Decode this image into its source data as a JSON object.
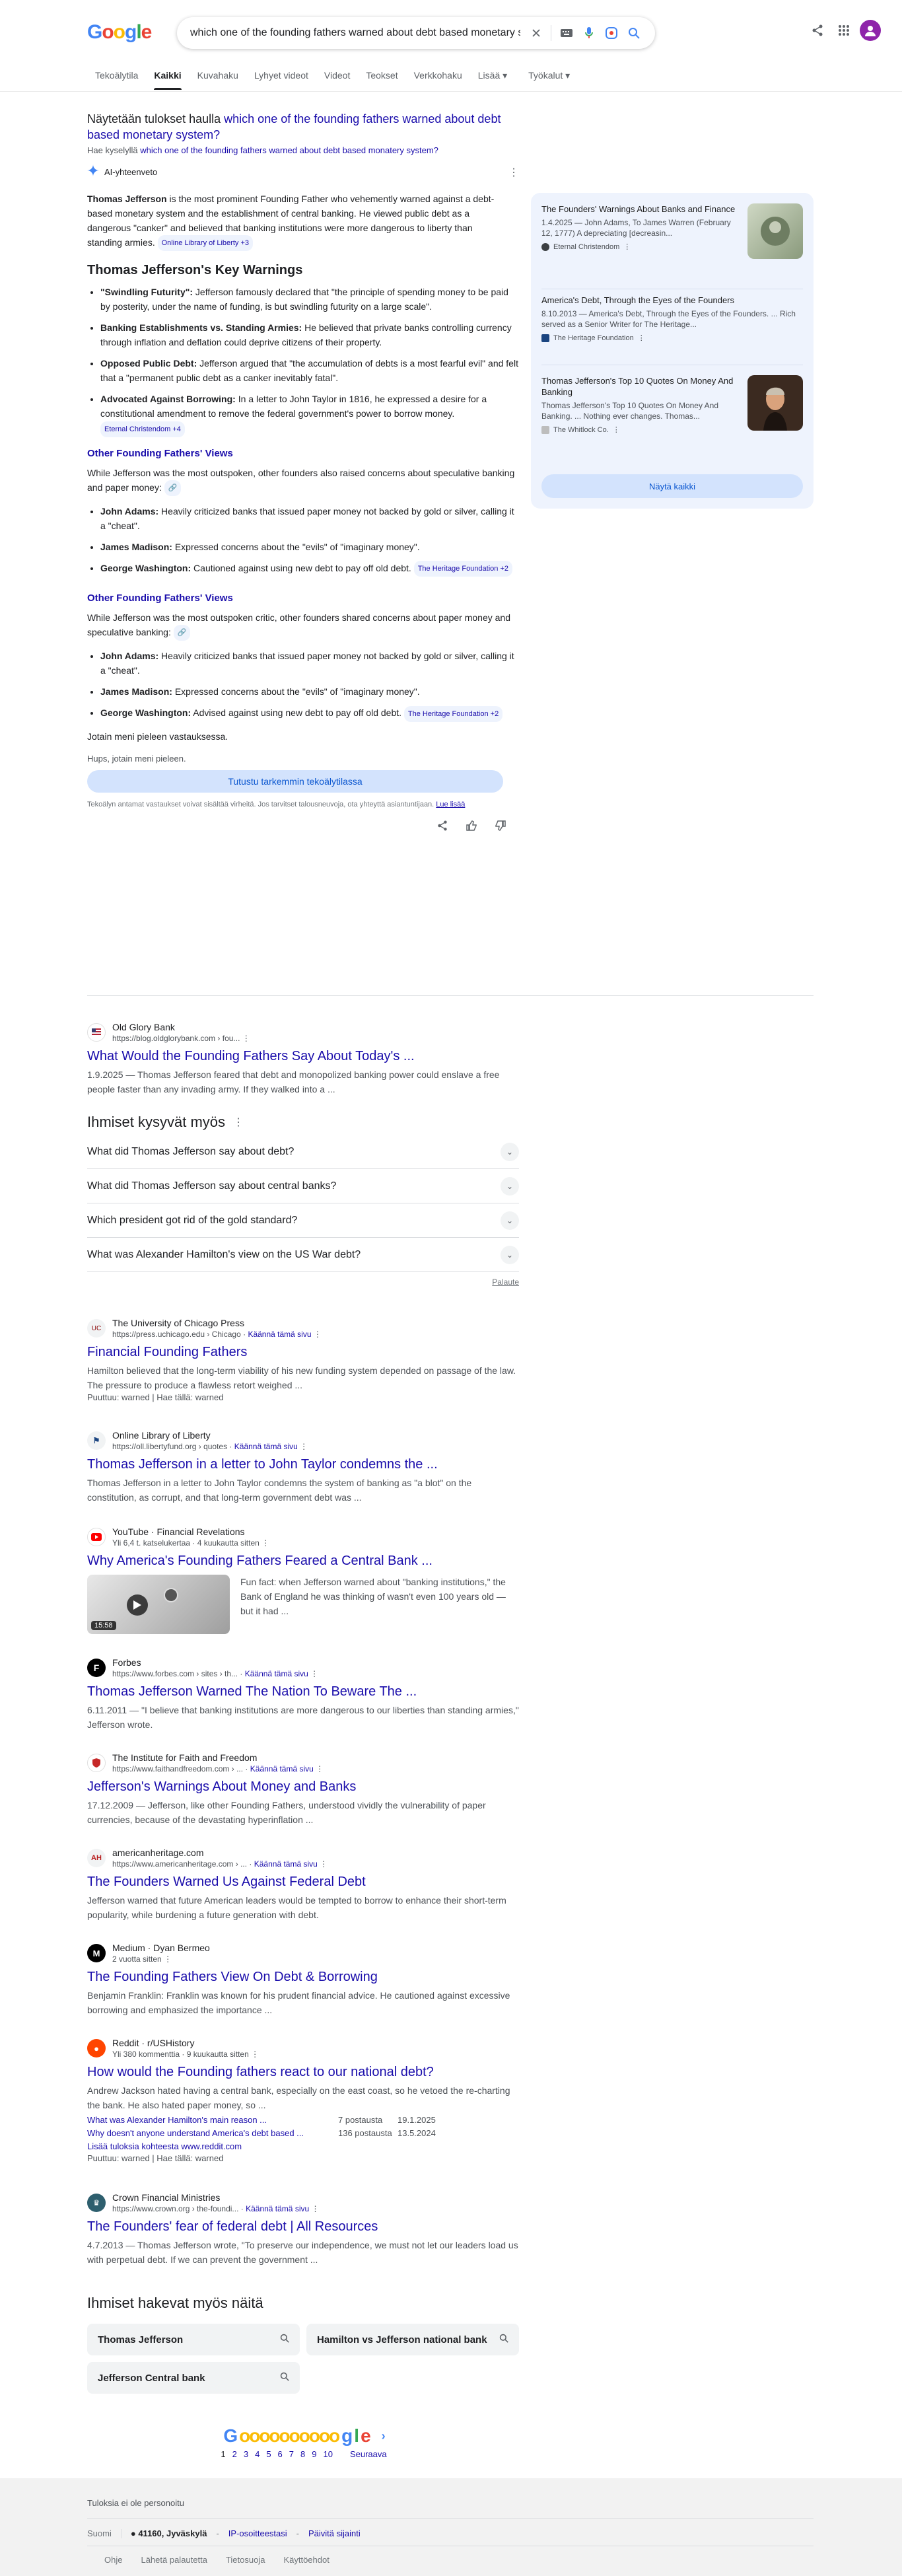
{
  "header": {
    "logo": "Google",
    "query": "which one of the founding fathers warned about debt based monetary system?"
  },
  "tabs": [
    "Tekoälytila",
    "Kaikki",
    "Kuvahaku",
    "Lyhyet videot",
    "Videot",
    "Teokset",
    "Verkkohaku",
    "Lisää ▾",
    "Työkalut ▾"
  ],
  "spell": {
    "prefix": "Näytetään tulokset haulla",
    "corrected": "which one of the founding fathers warned about debt based monetary system?",
    "alt_prefix": "Hae kyselyllä",
    "alt": "which one of the founding fathers warned about debt based monatery system?"
  },
  "ai": {
    "label": "AI-yhteenveto",
    "intro_bold": "Thomas Jefferson",
    "intro": " is the most prominent Founding Father who vehemently warned against a debt-based monetary system and the establishment of central banking. He viewed public debt as a dangerous \"canker\" and believed that banking institutions were more dangerous to liberty than standing armies.",
    "intro_chip": "Online Library of Liberty +3",
    "h2": "Thomas Jefferson's Key Warnings",
    "key": [
      {
        "b": "\"Swindling Futurity\":",
        "t": " Jefferson famously declared that \"the principle of spending money to be paid by posterity, under the name of funding, is but swindling futurity on a large scale\"."
      },
      {
        "b": "Banking Establishments vs. Standing Armies:",
        "t": " He believed that private banks controlling currency through inflation and deflation could deprive citizens of their property."
      },
      {
        "b": "Opposed Public Debt:",
        "t": " Jefferson argued that \"the accumulation of debts is a most fearful evil\" and felt that a \"permanent public debt as a canker inevitably fatal\"."
      },
      {
        "b": "Advocated Against Borrowing:",
        "t": " In a letter to John Taylor in 1816, he expressed a desire for a constitutional amendment to remove the federal government's power to borrow money.",
        "chip": "Eternal Christendom +4"
      }
    ],
    "h3a": "Other Founding Fathers' Views",
    "pa": "While Jefferson was the most outspoken, other founders also raised concerns about speculative banking and paper money:",
    "others_a": [
      {
        "b": "John Adams:",
        "t": " Heavily criticized banks that issued paper money not backed by gold or silver, calling it a \"cheat\"."
      },
      {
        "b": "James Madison:",
        "t": " Expressed concerns about the \"evils\" of \"imaginary money\"."
      },
      {
        "b": "George Washington:",
        "t": " Cautioned against using new debt to pay off old debt.",
        "chip": "The Heritage Foundation +2"
      }
    ],
    "h3b": "Other Founding Fathers' Views",
    "pb": "While Jefferson was the most outspoken critic, other founders shared concerns about paper money and speculative banking:",
    "others_b": [
      {
        "b": "John Adams:",
        "t": " Heavily criticized banks that issued paper money not backed by gold or silver, calling it a \"cheat\"."
      },
      {
        "b": "James Madison:",
        "t": " Expressed concerns about the \"evils\" of \"imaginary money\"."
      },
      {
        "b": "George Washington:",
        "t": " Advised against using new debt to pay off old debt.",
        "chip": "The Heritage Foundation +2"
      }
    ],
    "err1": "Jotain meni pieleen vastauksessa.",
    "err2": "Hups, jotain meni pieleen.",
    "explore": "Tutustu tarkemmin tekoälytilassa",
    "disclaimer": "Tekoälyn antamat vastaukset voivat sisältää virheitä. Jos tarvitset talousneuvoja, ota yhteyttä asiantuntijaan.",
    "learn": "Lue lisää"
  },
  "sources": {
    "items": [
      {
        "title": "The Founders' Warnings About Banks and Finance",
        "desc": "1.4.2025 — John Adams, To James Warren (February 12, 1777) A depreciating [decreasin...",
        "site": "Eternal Christendom"
      },
      {
        "title": "America's Debt, Through the Eyes of the Founders",
        "desc": "8.10.2013 — America's Debt, Through the Eyes of the Founders. ... Rich served as a Senior Writer for The Heritage...",
        "site": "The Heritage Foundation"
      },
      {
        "title": "Thomas Jefferson's Top 10 Quotes On Money And Banking",
        "desc": "Thomas Jefferson's Top 10 Quotes On Money And Banking. ... Nothing ever changes. Thomas...",
        "site": "The Whitlock Co."
      }
    ],
    "show_all": "Näytä kaikki"
  },
  "r1": {
    "name": "Old Glory Bank",
    "url": "https://blog.oldglorybank.com › fou...",
    "title": "What Would the Founding Fathers Say About Today's ...",
    "snip": "1.9.2025 — Thomas Jefferson feared that debt and monopolized banking power could enslave a free people faster than any invading army. If they walked into a ..."
  },
  "paa": {
    "title": "Ihmiset kysyvät myös",
    "qs": [
      "What did Thomas Jefferson say about debt?",
      "What did Thomas Jefferson say about central banks?",
      "Which president got rid of the gold standard?",
      "What was Alexander Hamilton's view on the US War debt?"
    ],
    "feedback": "Palaute"
  },
  "results": [
    {
      "name": "The University of Chicago Press",
      "url": "https://press.uchicago.edu › Chicago",
      "tr": "Käännä tämä sivu",
      "title": "Financial Founding Fathers",
      "snip": "Hamilton believed that the long-term viability of his new funding system depended on passage of the law. The pressure to produce a flawless retort weighed ...",
      "extra": "Puuttuu: warned | Hae tällä: warned"
    },
    {
      "name": "Online Library of Liberty",
      "url": "https://oll.libertyfund.org › quotes",
      "tr": "Käännä tämä sivu",
      "title": "Thomas Jefferson in a letter to John Taylor condemns the ...",
      "snip": "Thomas Jefferson in a letter to John Taylor condemns the system of banking as \"a blot\" on the constitution, as corrupt, and that long-term government debt was ..."
    },
    {
      "name": "YouTube · Financial Revelations",
      "url": "Yli 6,4 t. katselukertaa · 4 kuukautta sitten",
      "title": "Why America's Founding Fathers Feared a Central Bank ...",
      "snip": "Fun fact: when Jefferson warned about \"banking institutions,\" the Bank of England he was thinking of wasn't even 100 years old — but it had ...",
      "dur": "15:58"
    },
    {
      "name": "Forbes",
      "url": "https://www.forbes.com › sites › th...",
      "tr": "Käännä tämä sivu",
      "title": "Thomas Jefferson Warned The Nation To Beware The ...",
      "snip": "6.11.2011 — \"I believe that banking institutions are more dangerous to our liberties than standing armies,\" Jefferson wrote."
    },
    {
      "name": "The Institute for Faith and Freedom",
      "url": "https://www.faithandfreedom.com › ...",
      "tr": "Käännä tämä sivu",
      "title": "Jefferson's Warnings About Money and Banks",
      "snip": "17.12.2009 — Jefferson, like other Founding Fathers, understood vividly the vulnerability of paper currencies, because of the devastating hyperinflation ..."
    },
    {
      "name": "americanheritage.com",
      "url": "https://www.americanheritage.com › ...",
      "tr": "Käännä tämä sivu",
      "title": "The Founders Warned Us Against Federal Debt",
      "snip": "Jefferson warned that future American leaders would be tempted to borrow to enhance their short-term popularity, while burdening a future generation with debt."
    },
    {
      "name": "Medium · Dyan Bermeo",
      "url": "2 vuotta sitten",
      "title": "The Founding Fathers View On Debt & Borrowing",
      "snip": "Benjamin Franklin: Franklin was known for his prudent financial advice. He cautioned against excessive borrowing and emphasized the importance ..."
    },
    {
      "name": "Reddit · r/USHistory",
      "url": "Yli 380 kommenttia · 9 kuukautta sitten",
      "title": "How would the Founding fathers react to our national debt?",
      "snip": "Andrew Jackson hated having a central bank, especially on the east coast, so he vetoed the re-charting the bank. He also hated paper money, so ...",
      "sub": [
        {
          "q": "What was Alexander Hamilton's main reason ...",
          "n": "7 postausta",
          "d": "19.1.2025"
        },
        {
          "q": "Why doesn't anyone understand America's debt based ...",
          "n": "136 postausta",
          "d": "13.5.2024"
        }
      ],
      "more": "Lisää tuloksia kohteesta www.reddit.com",
      "extra": "Puuttuu: warned | Hae tällä: warned"
    },
    {
      "name": "Crown Financial Ministries",
      "url": "https://www.crown.org › the-foundi...",
      "tr": "Käännä tämä sivu",
      "title": "The Founders' fear of federal debt | All Resources",
      "snip": "4.7.2013 — Thomas Jefferson wrote, \"To preserve our independence, we must not let our leaders load us with perpetual debt. If we can prevent the government ..."
    }
  ],
  "related": {
    "title": "Ihmiset hakevat myös näitä",
    "items": [
      "Thomas Jefferson",
      "Hamilton vs Jefferson national bank",
      "Jefferson Central bank"
    ]
  },
  "pager": {
    "pages": [
      "1",
      "2",
      "3",
      "4",
      "5",
      "6",
      "7",
      "8",
      "9",
      "10"
    ],
    "next": "Seuraava"
  },
  "footer": {
    "note": "Tuloksia ei ole personoitu",
    "country": "Suomi",
    "loc": "41160, Jyväskylä",
    "ip": "IP-osoitteestasi",
    "update": "Päivitä sijainti",
    "links": [
      "Ohje",
      "Lähetä palautetta",
      "Tietosuoja",
      "Käyttöehdot"
    ]
  },
  "colors": {
    "link": "#1a0dab",
    "accent": "#0b57d0",
    "panel": "#eef3fd"
  }
}
